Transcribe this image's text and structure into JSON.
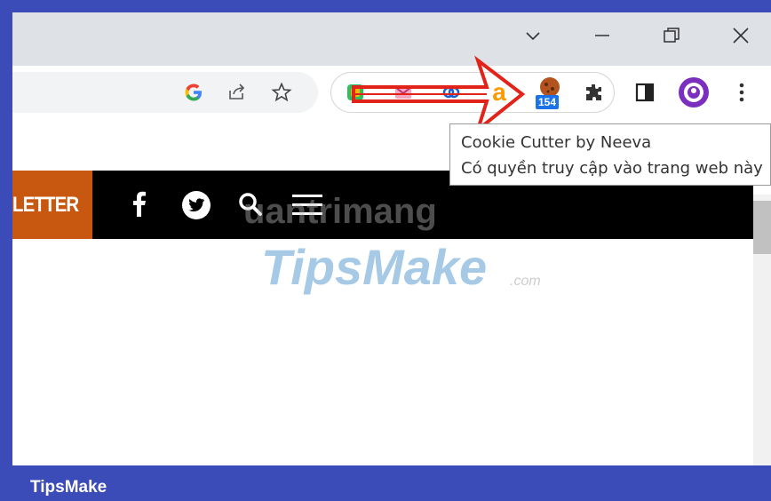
{
  "window": {
    "controls": [
      "chevron-down",
      "minimize",
      "restore",
      "close"
    ]
  },
  "toolbar": {
    "omnibox_icons": [
      "google-icon",
      "share-icon",
      "star-icon"
    ],
    "extensions": [
      "evernote-icon",
      "gmail-icon",
      "link-icon",
      "amazon-icon",
      "cookie-cutter-icon"
    ],
    "cookie_badge": "154",
    "right_icons": [
      "puzzle-icon",
      "side-panel-icon",
      "profile-icon",
      "kebab-menu-icon"
    ]
  },
  "tooltip": {
    "title": "Cookie Cutter by Neeva",
    "subtitle": "Có quyền truy cập vào trang web này"
  },
  "site_nav": {
    "newsletter_label": "LETTER",
    "icons": [
      "facebook-icon",
      "twitter-icon",
      "search-icon",
      "hamburger-menu-icon"
    ]
  },
  "watermark": {
    "top": "uantrimang",
    "main": "TipsMake",
    "suffix": ".com"
  },
  "footer": {
    "label": "TipsMake"
  },
  "colors": {
    "frame": "#3b4bb8",
    "annotation_arrow": "#e2231a",
    "newsletter_bg": "#c8580f",
    "badge_bg": "#1a73e8"
  }
}
